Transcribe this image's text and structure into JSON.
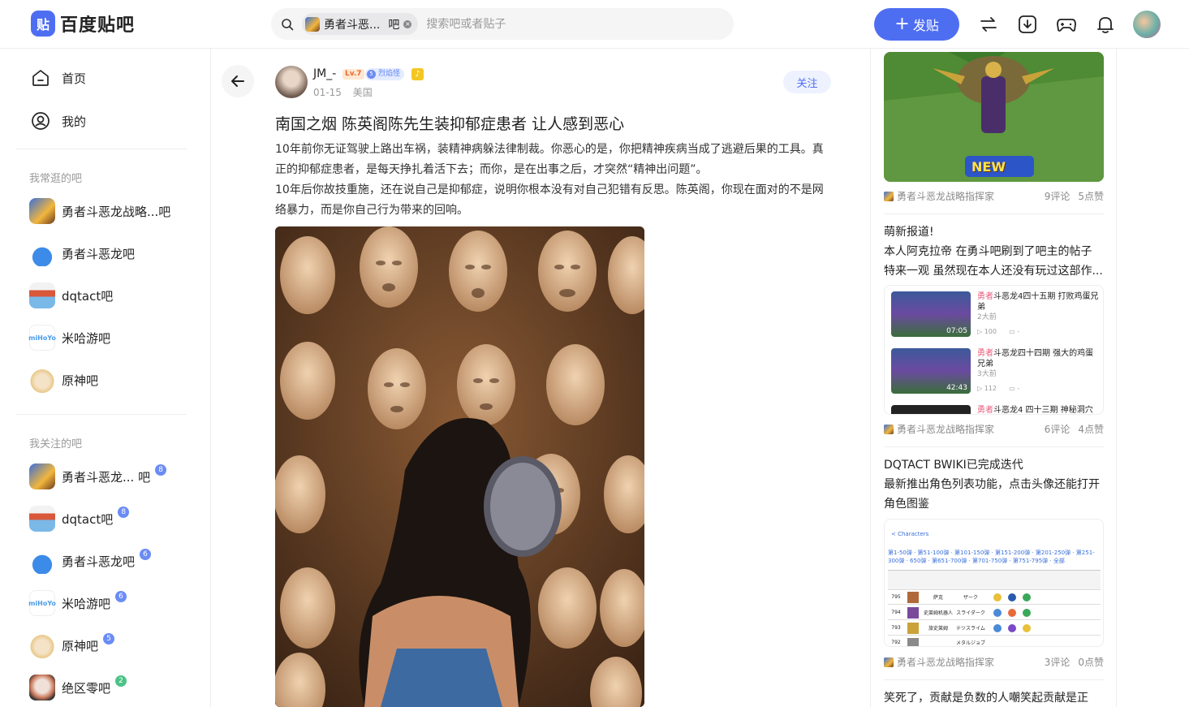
{
  "header": {
    "logo_mark": "贴",
    "logo_text": "百度贴吧",
    "search": {
      "chip_name": "勇者斗恶...",
      "chip_suffix": "吧",
      "placeholder": "搜索吧或者贴子"
    },
    "post_button": "发贴",
    "icons": [
      "swap-icon",
      "download-icon",
      "gamepad-icon",
      "bell-icon"
    ]
  },
  "sidebar": {
    "nav": [
      {
        "label": "首页",
        "icon": "home-icon"
      },
      {
        "label": "我的",
        "icon": "user-icon"
      }
    ],
    "frequent_title": "我常逛的吧",
    "frequent": [
      {
        "name": "勇者斗恶龙战略...吧",
        "color": "#3a6fd8"
      },
      {
        "name": "勇者斗恶龙吧",
        "color": "#3d8be8"
      },
      {
        "name": "dqtact吧",
        "color": "#d9583a"
      },
      {
        "name": "米哈游吧",
        "color": "#4b9be8"
      },
      {
        "name": "原神吧",
        "color": "#e8c98a"
      }
    ],
    "following_title": "我关注的吧",
    "following": [
      {
        "name": "勇者斗恶龙...  吧",
        "level": "8",
        "color": "#3a6fd8"
      },
      {
        "name": "dqtact吧",
        "level": "8",
        "color": "#d9583a"
      },
      {
        "name": "勇者斗恶龙吧",
        "level": "6",
        "color": "#3d8be8"
      },
      {
        "name": "米哈游吧",
        "level": "6",
        "color": "#4b9be8"
      },
      {
        "name": "原神吧",
        "level": "5",
        "color": "#e8c98a"
      },
      {
        "name": "绝区零吧",
        "level": "2",
        "color": "#c9775a"
      }
    ]
  },
  "post": {
    "author": "JM_-",
    "level_badge": "Lv.7",
    "title_badge_num": "5",
    "title_badge": "烈焰怪",
    "date": "01-15",
    "location": "美国",
    "follow_label": "关注",
    "title": "南国之烟 陈英阁陈先生装抑郁症患者 让人感到恶心",
    "paragraphs": [
      "10年前你无证驾驶上路出车祸，装精神病躲法律制裁。你恶心的是，你把精神疾病当成了逃避后果的工具。真正的抑郁症患者，是每天挣扎着活下去；而你，是在出事之后，才突然“精神出问题”。",
      "10年后你故技重施，还在说自己是抑郁症，说明你根本没有对自己犯错有反思。陈英阁，你现在面对的不是网络暴力，而是你自己行为带来的回响。"
    ]
  },
  "right": {
    "card1": {
      "badge": "NEW",
      "forum": "勇者斗恶龙战略指挥家",
      "comments": "9评论",
      "likes": "5点赞"
    },
    "card2": {
      "lines": [
        "萌新报道!",
        "本人阿克拉帝 在勇斗吧刷到了吧主的帖子",
        "特来一观 虽然现在本人还没有玩过这部作..."
      ],
      "videos": [
        {
          "hl": "勇者",
          "title": "斗恶龙4四十五期 打败鸡蛋兄弟",
          "time": "2大前",
          "views": "100",
          "danmaku": "-",
          "duration": "07:05"
        },
        {
          "hl": "勇者",
          "title": "斗恶龙四十四期 强大的鸡蛋兄弟",
          "time": "3大前",
          "views": "112",
          "danmaku": "-",
          "duration": "42:43"
        },
        {
          "hl": "勇者",
          "title": "斗恶龙4 四十三期 神秘洞穴",
          "time": "",
          "views": "",
          "danmaku": "",
          "duration": ""
        }
      ],
      "forum": "勇者斗恶龙战略指挥家",
      "comments": "6评论",
      "likes": "4点赞"
    },
    "card3": {
      "lines": [
        "DQTACT BWIKI已完成迭代",
        "最新推出角色列表功能，点击头像还能打开",
        "角色图鉴"
      ],
      "table_header": "< Characters",
      "table_links": "第1-50弹 · 第51-100弹 · 第101-150弹 · 第151-200弹 · 第201-250弹 · 第251-300弹 · 650弹 · 第651-700弹 · 第701-750弹 · 第751-795弹 · 全部",
      "table_rows": [
        {
          "num": "795",
          "name": "萨克",
          "kana": "ザーク"
        },
        {
          "num": "794",
          "name": "史莱姆机器人",
          "kana": "スライダーク"
        },
        {
          "num": "793",
          "name": "旅史莱姆",
          "kana": "テツスライム"
        },
        {
          "num": "792",
          "name": "",
          "kana": "メタルジョブ"
        }
      ],
      "forum": "勇者斗恶龙战略指挥家",
      "comments": "3评论",
      "likes": "0点赞"
    },
    "card4_line": "笑死了，贡献是负数的人嘲笑起贡献是正"
  }
}
